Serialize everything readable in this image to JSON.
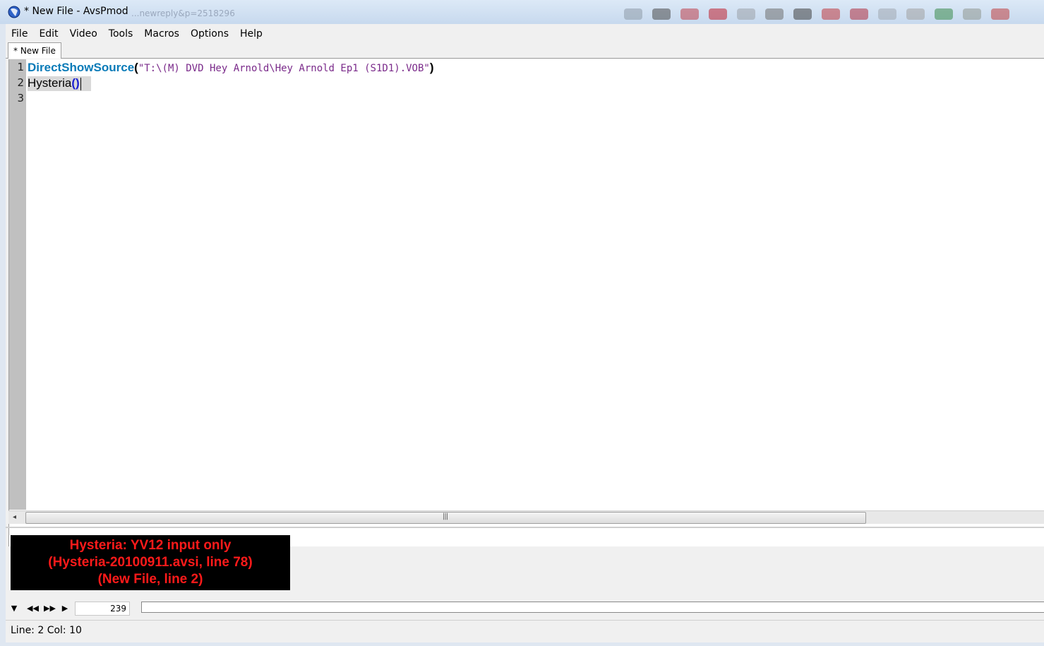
{
  "window": {
    "title": "* New File - AvsPmod",
    "background_url_ghost": "...newreply&p=2518296"
  },
  "menu": [
    "File",
    "Edit",
    "Video",
    "Tools",
    "Macros",
    "Options",
    "Help"
  ],
  "tabs": [
    {
      "label": "* New File",
      "active": true
    }
  ],
  "editor": {
    "line_numbers": [
      "1",
      "2",
      "3"
    ],
    "line1": {
      "command": "DirectShowSource",
      "open": "(",
      "string": "\"T:\\(M) DVD Hey Arnold\\Hey Arnold Ep1 (S1D1).VOB\"",
      "close": ")"
    },
    "line2": {
      "command": "Hysteria",
      "parens": "()"
    }
  },
  "preview": {
    "error_lines": [
      "Hysteria: YV12 input only",
      "(Hysteria-20100911.avsi, line 78)",
      "(New File, line 2)"
    ],
    "error_color": "#ff1a1a"
  },
  "transport": {
    "buttons": [
      "toggle-video-icon",
      "step-back-icon",
      "step-forward-icon",
      "play-icon"
    ],
    "frame": "239"
  },
  "status": {
    "text": "Line: 2  Col: 10"
  },
  "colors": {
    "keyword": "#0a7bb8",
    "string": "#7a2a8a",
    "bracket": "#1b20d4"
  }
}
